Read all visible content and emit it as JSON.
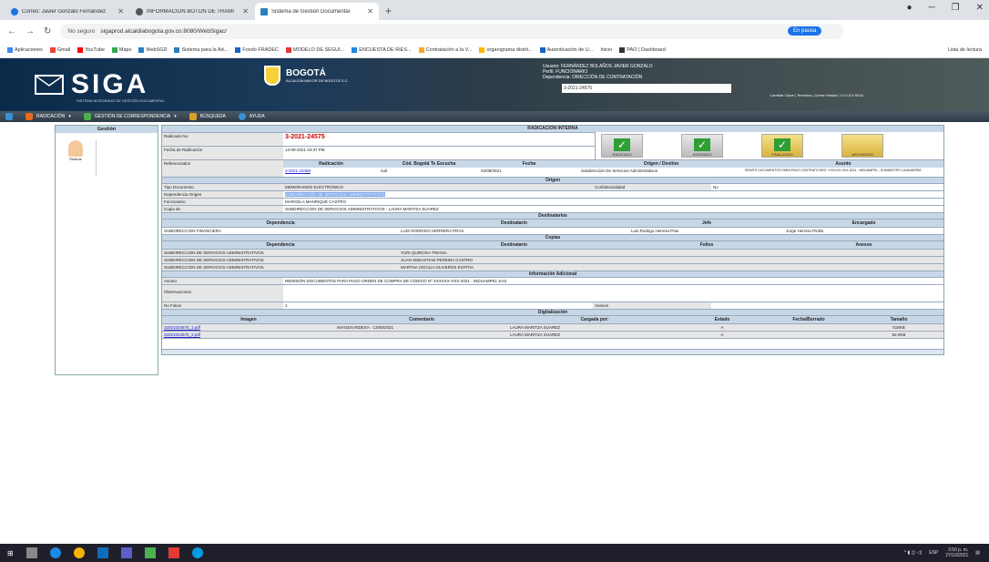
{
  "browser": {
    "tabs": [
      {
        "label": "Correo: Javier Gonzalo Fernández",
        "color": "#1a73e8"
      },
      {
        "label": "INFORMACIÓN BOTÓN DE TRAMI",
        "color": "#555555"
      },
      {
        "label": "Sistema de Gestión Documental",
        "color": "#2b7fbf"
      }
    ],
    "url_security": "No seguro",
    "url": "sigaprod.alcaldiabogota.gov.co:8080/WebSigac/",
    "pause_label": "En pausa",
    "bookmarks": [
      "Aplicaciones",
      "Gmail",
      "YouTube",
      "Maps",
      "WebSGD",
      "Sistema para la Ad...",
      "Fondo FRADEC",
      "MODELO DE SEGUI...",
      "ENCUESTA DE RIES...",
      "Contratación a la V...",
      "organigrama distrit...",
      "Autenticación de U...",
      "Inicio",
      "PAO | Dashboard"
    ],
    "reading_list": "Lista de lectura"
  },
  "banner": {
    "brand": "SIGA",
    "brand_sub": "SISTEMA INTEGRADO DE GESTIÓN DOCUMENTAL",
    "city": "BOGOTÁ",
    "city_sub": "ALCALDÍA MAYOR DE BOGOTÁ D.C.",
    "user_line1": "Usuario: FERNÁNDEZ BOLAÑOS JAVIER GONZALO",
    "user_line2": "Perfil: FUNCIONARIO",
    "user_line3": "Dependencia: DIRECCIÓN DE CONTRATACIÓN",
    "search_value": "3-2021-24575",
    "right_links": "Cambiar Clave | Terminos | Cerrar Sesión | V1.0.0.0 SIGA"
  },
  "menu": [
    {
      "label": "RADICACIÓN",
      "color": "#e66b1a"
    },
    {
      "label": "GESTIÓN DE CORRESPONDENCIA",
      "color": "#4caf50"
    },
    {
      "label": "BÚSQUEDA",
      "color": "#d8a02a"
    },
    {
      "label": "AYUDA",
      "color": "#3a8fd8"
    }
  ],
  "left_panel": {
    "title": "Gestión",
    "avatar_label": "Radicar"
  },
  "form": {
    "title": "RADICACION INTERNA",
    "radicado_label": "Radicado No.",
    "radicado_value": "3-2021-24575",
    "fecha_label": "Fecha de Radicación",
    "fecha_value": "13-09-2021 04:37 PM",
    "status_buttons": [
      "RADICADO",
      "ASIGNADO",
      "FINALIZADO",
      "ARCHIVADO"
    ],
    "referenciados_label": "Referenciados",
    "ref_headers": [
      "Radicación",
      "Cód. Bogotá Te Escucha",
      "Fecha",
      "Origen / Destino",
      "Asunto"
    ],
    "ref_row": [
      "3-2021-23459",
      "null",
      "02/08/2021",
      "Subdirección De Servicios Administrativos",
      "REMITE DOCUMENTOS PARA PAGO CONTRATO NRO. XXXXXX-XXX-2021 - INDUAMPEL - SUMINISTRO LAVANDERÍA"
    ],
    "origen_title": "Origen",
    "origen_rows": [
      [
        "Tipo Documento",
        "MEMORANDO ELECTRONICO",
        "Confidencialidad",
        "No"
      ],
      [
        "Dependencia Origen",
        "SUBDIRECCION DE SERVICIOS ADMINISTRATIVOS"
      ],
      [
        "Funcionario",
        "MARCELA MANRIQUE CASTRO"
      ],
      [
        "Copia de",
        "SUBDIRECCION DE SERVICIOS ADMINISTRATIVOS - LAURA MARITZA SUAREZ"
      ]
    ],
    "dest_title": "Destinatarios",
    "dest_headers": [
      "Dependencia",
      "Destinatario",
      "Jefe",
      "Encargado"
    ],
    "dest_row": [
      "SUBDIRECCION FINANCIERA",
      "LUIS RODRIGO HERRERA PRAS",
      "Luis Rodrigo Herrera Pras",
      "Jorge Herrera Pinilla"
    ],
    "copias_title": "Copias",
    "copias_headers": [
      "Dependencia",
      "Destinatario",
      "Folios",
      "Anexos"
    ],
    "copias_rows": [
      [
        "SUBDIRECCION DE SERVICIOS ADMINISTRATIVOS",
        "YURI QUIROGA TRIANA",
        "",
        ""
      ],
      [
        "SUBDIRECCION DE SERVICIOS ADMINISTRATIVOS",
        "JUAN SEBASTIAN PEREIRA CASTRO",
        "",
        ""
      ],
      [
        "SUBDIRECCION DE SERVICIOS ADMINISTRATIVOS",
        "MARTHA CECILIA OLIVEROS ESPITIA",
        "",
        ""
      ]
    ],
    "adicional_title": "Información Adicional",
    "asunto_label": "Asunto",
    "asunto_value": "REMISIÓN DOCUMENTOS PARA PAGO ORDEN DE COMPRA DE CÓDIGO Nº XXXXXX-XXX-2021 - INDUAMPEL SAS",
    "observaciones_label": "Observaciones",
    "folios_label": "No Folios",
    "folios_value": "1",
    "anexos_label": "Anexos",
    "digit_title": "Digitalización",
    "digit_headers": [
      "Imagen",
      "Comentario",
      "Cargada por:",
      "Estado",
      "Fecha/Borrado",
      "Tamaño"
    ],
    "digit_rows": [
      [
        "32021024575_1.pdf",
        "IMAGEN INDEXA - 13/09/2021",
        "LAURA MARITZA SUAREZ",
        "A",
        "",
        "518KB"
      ],
      [
        "32021024575_2.pdf",
        "",
        "LAURA MARITZA SUAREZ",
        "A",
        "",
        "82.0KB"
      ]
    ]
  },
  "taskbar": {
    "time": "3:50 p. m.",
    "date": "27/10/2021",
    "lang": "ESP"
  }
}
